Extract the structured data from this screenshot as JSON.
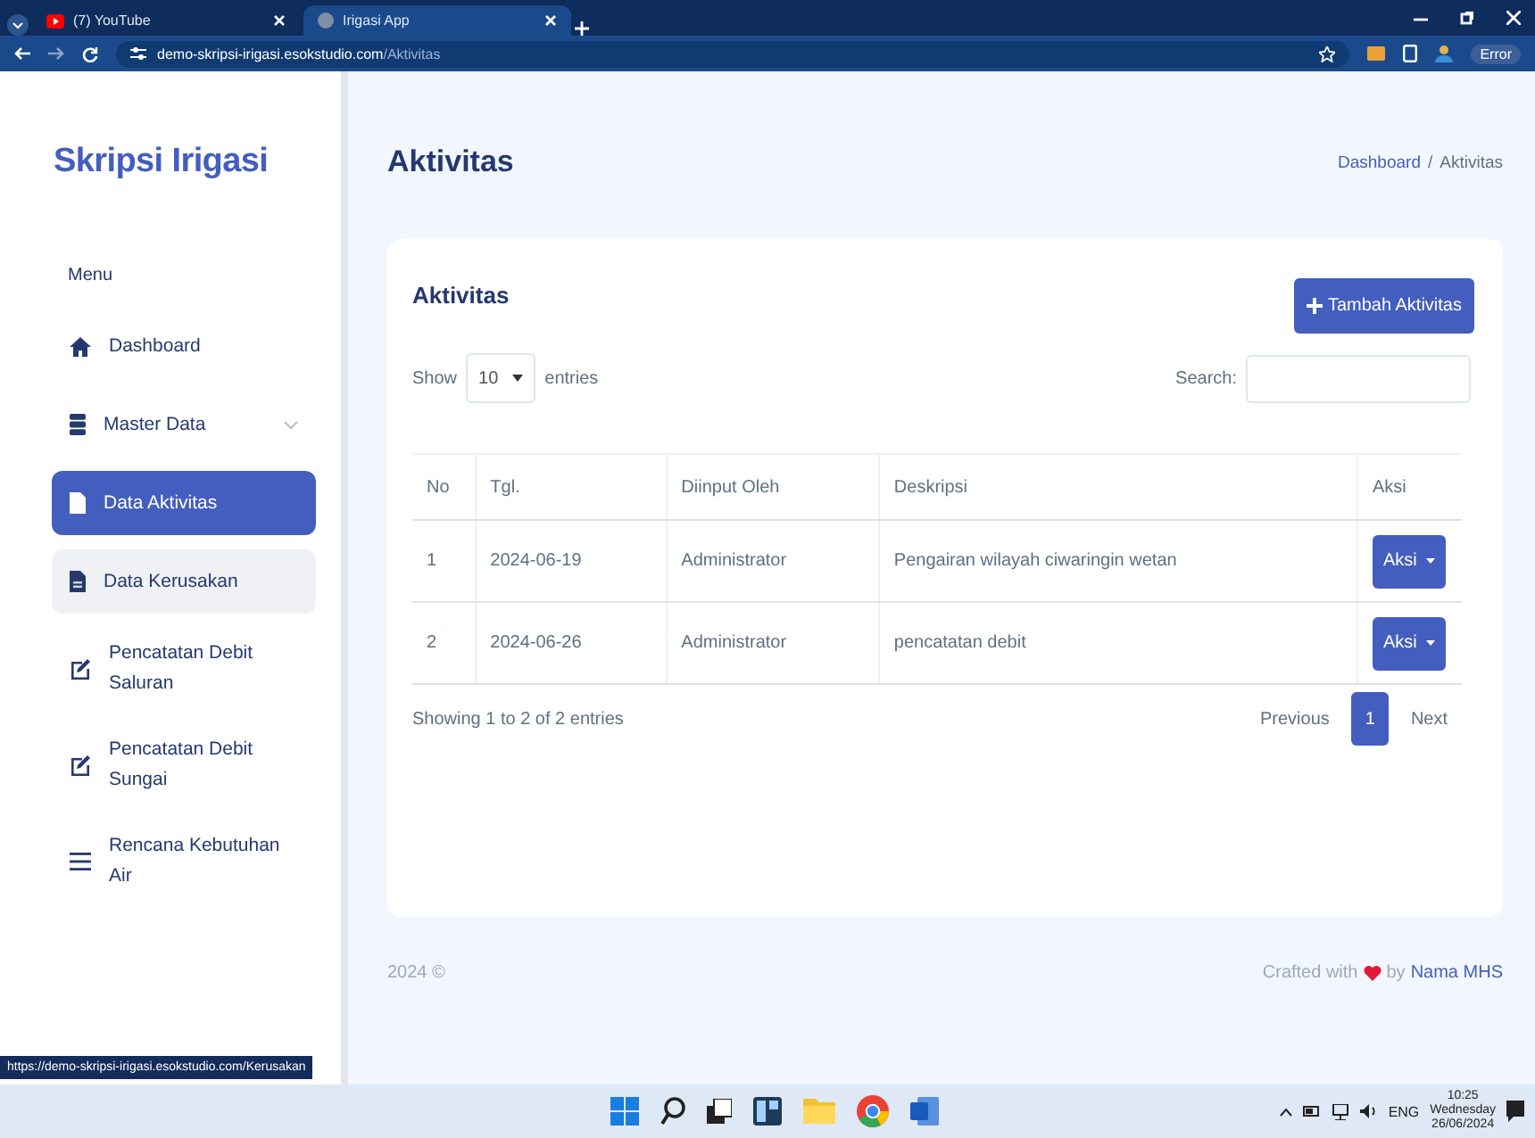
{
  "browser": {
    "tabs": [
      {
        "title": "(7) YouTube",
        "selected": false
      },
      {
        "title": "Irigasi App",
        "selected": true
      }
    ],
    "url_host": "demo-skripsi-irigasi.esokstudio.com",
    "url_path": "/Aktivitas",
    "profile_label": "Error"
  },
  "sidebar": {
    "brand": "Skripsi Irigasi",
    "section": "Menu",
    "items": [
      {
        "label": "Dashboard",
        "kind": "link",
        "selected": false,
        "hovered": false
      },
      {
        "label": "Master Data",
        "kind": "dropdown",
        "selected": false,
        "hovered": false
      },
      {
        "label": "Data Aktivitas",
        "kind": "link",
        "selected": true,
        "hovered": false
      },
      {
        "label": "Data Kerusakan",
        "kind": "link",
        "selected": false,
        "hovered": true
      },
      {
        "label": "Pencatatan Debit Saluran",
        "kind": "link",
        "selected": false,
        "hovered": false
      },
      {
        "label": "Pencatatan Debit Sungai",
        "kind": "link",
        "selected": false,
        "hovered": false
      },
      {
        "label": "Rencana Kebutuhan Air",
        "kind": "link",
        "selected": false,
        "hovered": false
      }
    ]
  },
  "status_url": "https://demo-skripsi-irigasi.esokstudio.com/Kerusakan",
  "page": {
    "title": "Aktivitas",
    "breadcrumb": {
      "items": [
        "Dashboard",
        "Aktivitas"
      ],
      "separator": "/"
    }
  },
  "card": {
    "title": "Aktivitas",
    "add_button": "Tambah Aktivitas",
    "show_label": "Show",
    "page_length": "10",
    "entries_label": "entries",
    "search_label": "Search:",
    "table": {
      "columns": [
        "No",
        "Tgl.",
        "Diinput Oleh",
        "Deskripsi",
        "Aksi"
      ],
      "rows": [
        {
          "cells": [
            "1",
            "2024-06-19",
            "Administrator",
            "Pengairan wilayah ciwaringin wetan"
          ],
          "action": "Aksi"
        },
        {
          "cells": [
            "2",
            "2024-06-26",
            "Administrator",
            "pencatatan debit"
          ],
          "action": "Aksi"
        }
      ]
    },
    "info": "Showing 1 to 2 of 2 entries",
    "pagination": {
      "previous": "Previous",
      "pages": [
        {
          "label": "1",
          "selected": true
        }
      ],
      "next": "Next"
    }
  },
  "footer": {
    "copyright": "2024 ©",
    "crafted": "Crafted with",
    "by": "by",
    "author": "Nama MHS"
  },
  "taskbar": {
    "language": "ENG",
    "time": "10:25",
    "day": "Wednesday",
    "date": "26/06/2024"
  }
}
